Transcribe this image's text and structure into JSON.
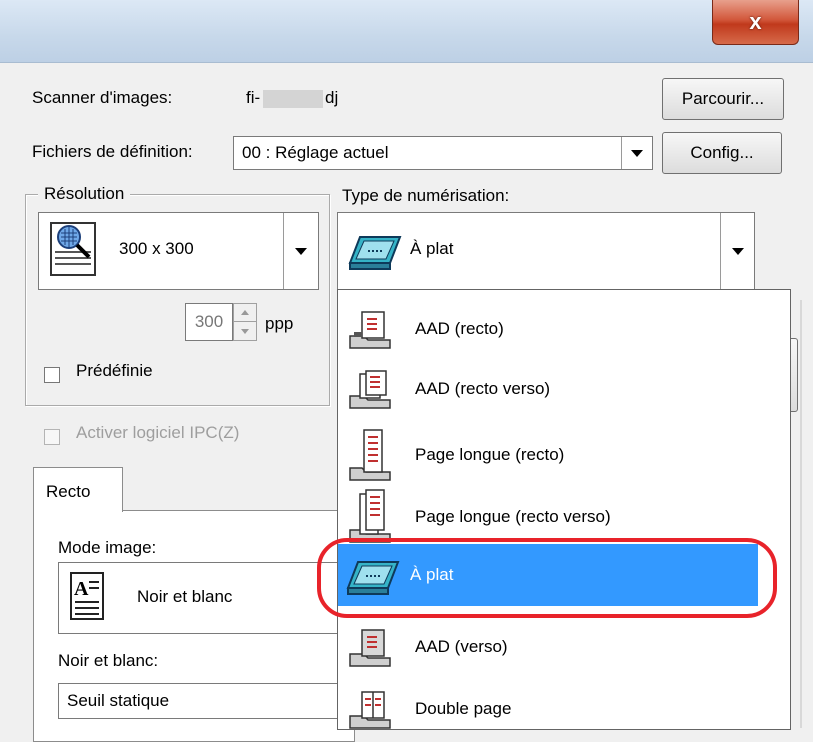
{
  "window": {
    "close_label": "x"
  },
  "scanner": {
    "label": "Scanner d'images:",
    "name_prefix": "fi-",
    "name_suffix": "dj",
    "browse_label": "Parcourir..."
  },
  "definition": {
    "label": "Fichiers de définition:",
    "value": "00 : Réglage actuel",
    "config_label": "Config..."
  },
  "resolution": {
    "group_label": "Résolution",
    "value": "300 x 300",
    "dpi_value": "300",
    "dpi_unit": "ppp",
    "predefined_label": "Prédéfinie"
  },
  "scan_type": {
    "label": "Type de numérisation:",
    "selected": "À plat",
    "options": [
      {
        "label": "AAD (recto)",
        "icon": "adf-front-icon"
      },
      {
        "label": "AAD (recto verso)",
        "icon": "adf-duplex-icon"
      },
      {
        "label": "Page longue (recto)",
        "icon": "long-page-front-icon"
      },
      {
        "label": "Page longue (recto verso)",
        "icon": "long-page-duplex-icon"
      },
      {
        "label": "À plat",
        "icon": "flatbed-icon",
        "selected": true
      },
      {
        "label": "AAD (verso)",
        "icon": "adf-back-icon"
      },
      {
        "label": "Double page",
        "icon": "double-page-icon"
      }
    ]
  },
  "ipc": {
    "label": "Activer logiciel IPC(Z)"
  },
  "tabs": [
    {
      "label": "Recto"
    }
  ],
  "image_mode": {
    "label": "Mode image:",
    "value": "Noir et blanc"
  },
  "bw": {
    "label": "Noir et blanc:",
    "value": "Seuil statique"
  },
  "more_button_label": "...",
  "colors": {
    "highlight": "#3399ff",
    "ring": "#e8232a"
  }
}
